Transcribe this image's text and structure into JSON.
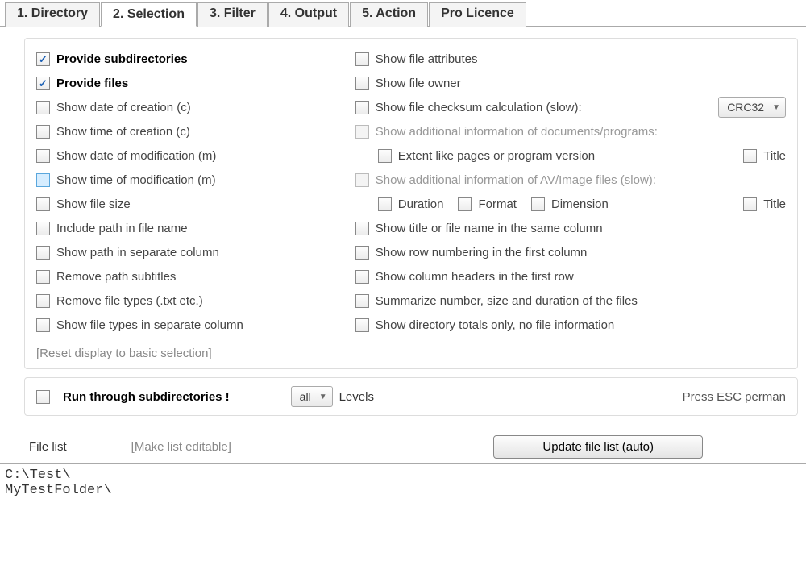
{
  "tabs": {
    "t1": "1. Directory",
    "t2": "2. Selection",
    "t3": "3. Filter",
    "t4": "4. Output",
    "t5": "5. Action",
    "t6": "Pro Licence"
  },
  "left": {
    "provide_subdirs": "Provide subdirectories",
    "provide_files": "Provide files",
    "date_creation": "Show date of creation (c)",
    "time_creation": "Show time of creation (c)",
    "date_mod": "Show date of modification (m)",
    "time_mod": "Show time of modification (m)",
    "file_size": "Show file size",
    "include_path": "Include path in file name",
    "path_sep_col": "Show path in separate column",
    "remove_subtitles": "Remove path subtitles",
    "remove_types": "Remove file types (.txt etc.)",
    "types_sep_col": "Show file types in separate column"
  },
  "right": {
    "attrs": "Show file attributes",
    "owner": "Show file owner",
    "checksum": "Show file checksum calculation (slow):",
    "checksum_alg": "CRC32",
    "doc_info": "Show additional information of documents/programs:",
    "extent": "Extent like pages or program version",
    "title1": "Title",
    "av_info": "Show additional information of AV/Image files (slow):",
    "duration": "Duration",
    "format": "Format",
    "dimension": "Dimension",
    "title2": "Title",
    "title_same": "Show title or file name in the same column",
    "row_num": "Show row numbering in the first column",
    "col_headers": "Show column headers in the first row",
    "summarize": "Summarize number, size and duration of the files",
    "dir_totals": "Show directory totals only, no file information"
  },
  "reset": "[Reset display to basic selection]",
  "run_through": "Run through subdirectories !",
  "levels_select": "all",
  "levels_label": "Levels",
  "esc_text": "Press ESC perman",
  "footer": {
    "label": "File list",
    "editable": "[Make list editable]",
    "update": "Update file list (auto)"
  },
  "file_output": "C:\\Test\\\nMyTestFolder\\"
}
